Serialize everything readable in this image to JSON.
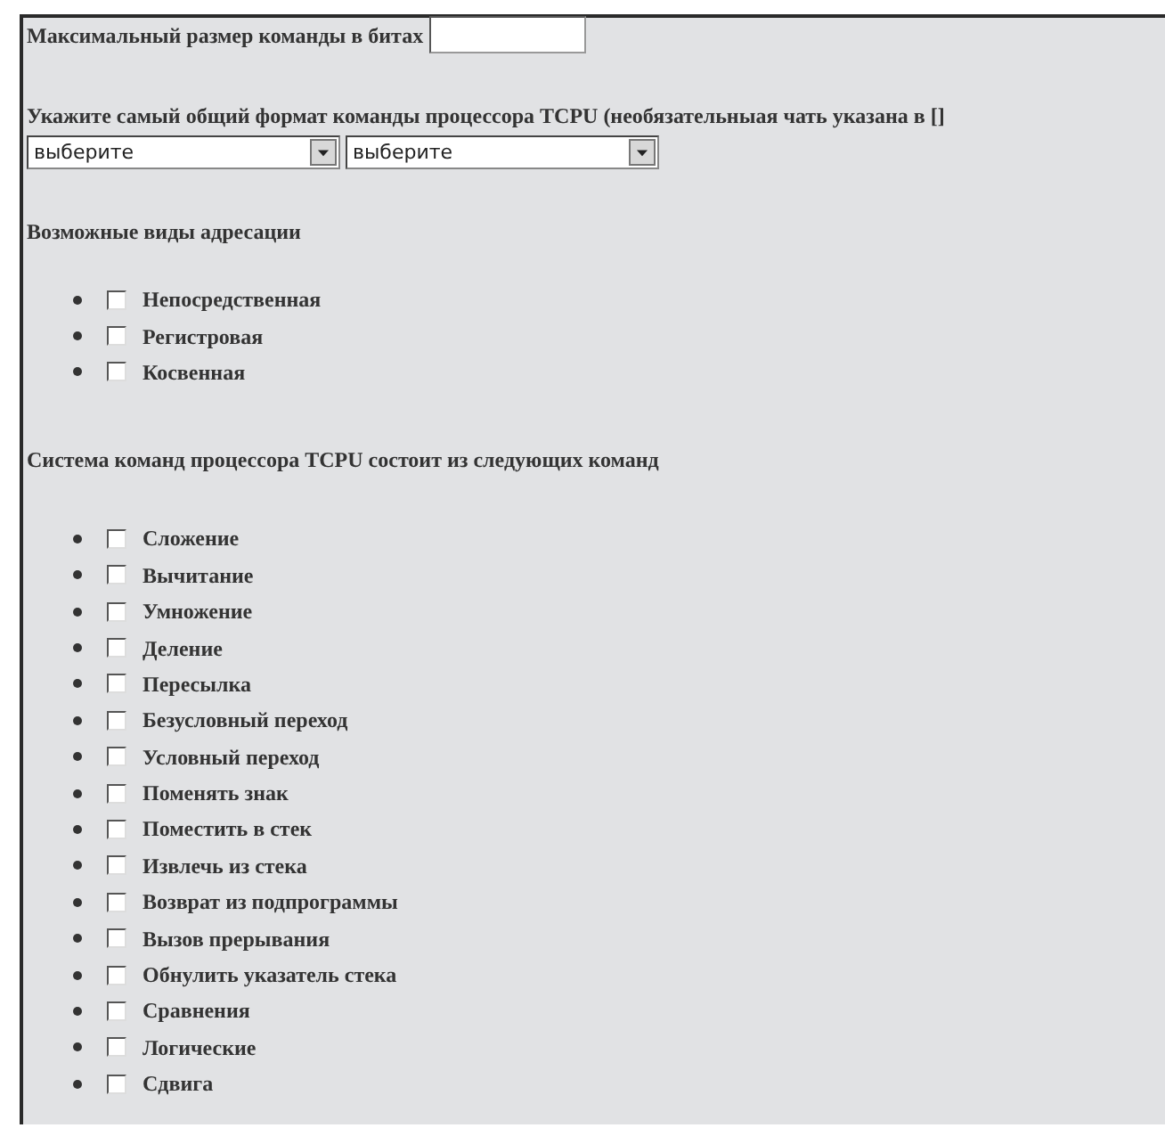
{
  "size_question": {
    "label": "Максимальный размер команды в битах"
  },
  "format_question": {
    "label": "Укажите самый общий формат команды процессора TCPU (необязательныая чать указана в []",
    "selects": [
      {
        "value": "выберите"
      },
      {
        "value": "выберите"
      }
    ]
  },
  "checkbox_groups": [
    {
      "title": "Возможные виды адресации",
      "options": [
        {
          "label": "Непосредственная",
          "checked": false
        },
        {
          "label": "Регистровая",
          "checked": false
        },
        {
          "label": "Косвенная",
          "checked": false
        }
      ]
    },
    {
      "title": "Система команд процессора TCPU состоит из следующих команд",
      "options": [
        {
          "label": "Сложение",
          "checked": false
        },
        {
          "label": "Вычитание",
          "checked": false
        },
        {
          "label": "Умножение",
          "checked": false
        },
        {
          "label": "Деление",
          "checked": false
        },
        {
          "label": "Пересылка",
          "checked": false
        },
        {
          "label": "Безусловный переход",
          "checked": false
        },
        {
          "label": "Условный переход",
          "checked": false
        },
        {
          "label": "Поменять знак",
          "checked": false
        },
        {
          "label": "Поместить в стек",
          "checked": false
        },
        {
          "label": "Извлечь из стека",
          "checked": false
        },
        {
          "label": "Возврат из подпрограммы",
          "checked": false
        },
        {
          "label": "Вызов прерывания",
          "checked": false
        },
        {
          "label": "Обнулить указатель стека",
          "checked": false
        },
        {
          "label": "Сравнения",
          "checked": false
        },
        {
          "label": "Логические",
          "checked": false
        },
        {
          "label": "Сдвига",
          "checked": false
        }
      ]
    }
  ]
}
